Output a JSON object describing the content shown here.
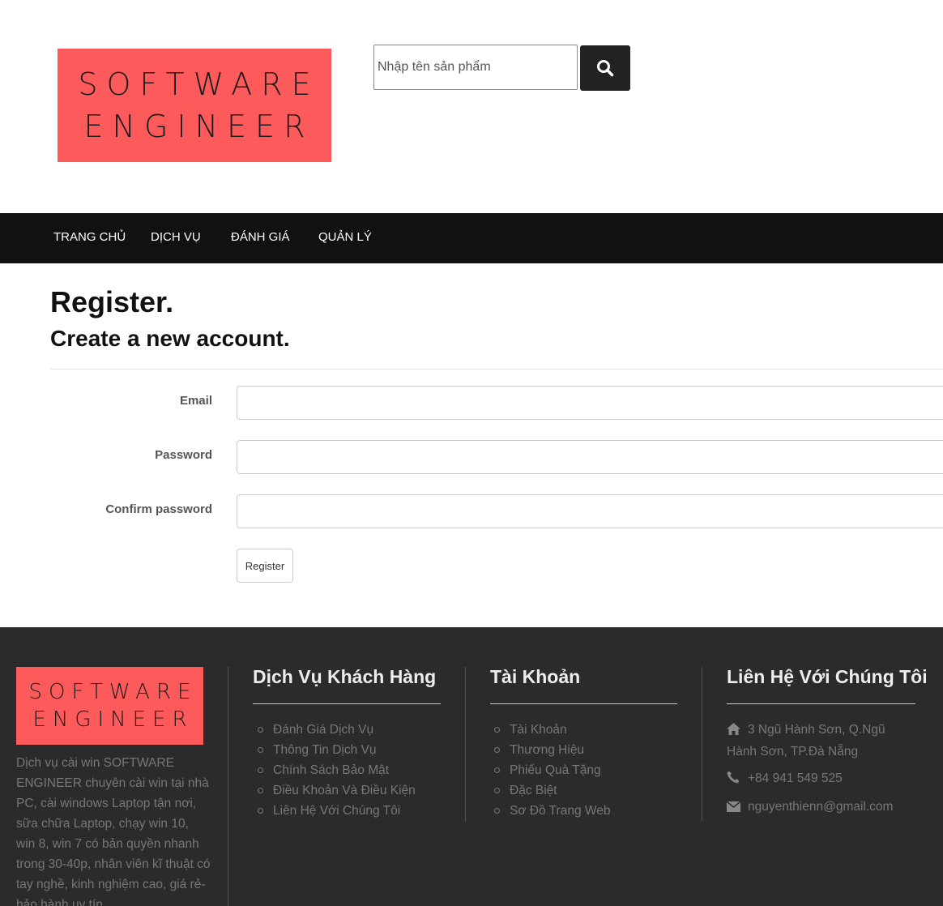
{
  "header": {
    "logo_line1": "SOFTWARE",
    "logo_line2": "ENGINEER",
    "search_placeholder": "Nhập tên sản phẩm",
    "search_icon": "search-icon"
  },
  "nav": {
    "items": [
      "TRANG CHỦ",
      "DỊCH VỤ",
      "ĐÁNH GIÁ",
      "QUẢN LÝ"
    ]
  },
  "main": {
    "title": "Register.",
    "subtitle": "Create a new account.",
    "email_label": "Email",
    "password_label": "Password",
    "confirm_label": "Confirm password",
    "email_value": "",
    "password_value": "",
    "confirm_value": "",
    "register_button": "Register"
  },
  "footer": {
    "logo_line1": "SOFTWARE",
    "logo_line2": "ENGINEER",
    "description": "Dịch vụ cài win SOFTWARE ENGINEER chuyên cài win tại nhà PC, cài windows Laptop tận nơi, sữa chữa Laptop, chạy win 10, win 8, win 7 có bản quyền nhanh trong 30-40p, nhân viên kĩ thuật có tay nghề, kinh nghiệm cao, giá rẻ- bảo hành uy tín",
    "services": {
      "heading": "Dịch Vụ Khách Hàng",
      "items": [
        "Đánh Giá Dịch Vụ",
        "Thông Tin Dịch Vụ",
        "Chính Sách Bảo Mật",
        "Điều Khoản Và Điều Kiện",
        "Liên Hệ Với Chúng Tôi"
      ]
    },
    "account": {
      "heading": "Tài Khoản",
      "items": [
        "Tài Khoản",
        "Thương Hiệu",
        "Phiếu Quà Tặng",
        "Đặc Biệt",
        "Sơ Đồ Trang Web"
      ]
    },
    "contact": {
      "heading": "Liên Hệ Với Chúng Tôi",
      "address": "3 Ngũ Hành Sơn, Q.Ngũ Hành Sơn, TP.Đà Nẵng",
      "phone": "+84 941 549 525",
      "email": "nguyenthienn@gmail.com",
      "icons": [
        "home-icon",
        "phone-icon",
        "envelope-icon"
      ]
    }
  },
  "colors": {
    "logo_bg": "#fd5b5b",
    "nav_bg": "#111111",
    "footer_bg": "#2b2b2b"
  }
}
